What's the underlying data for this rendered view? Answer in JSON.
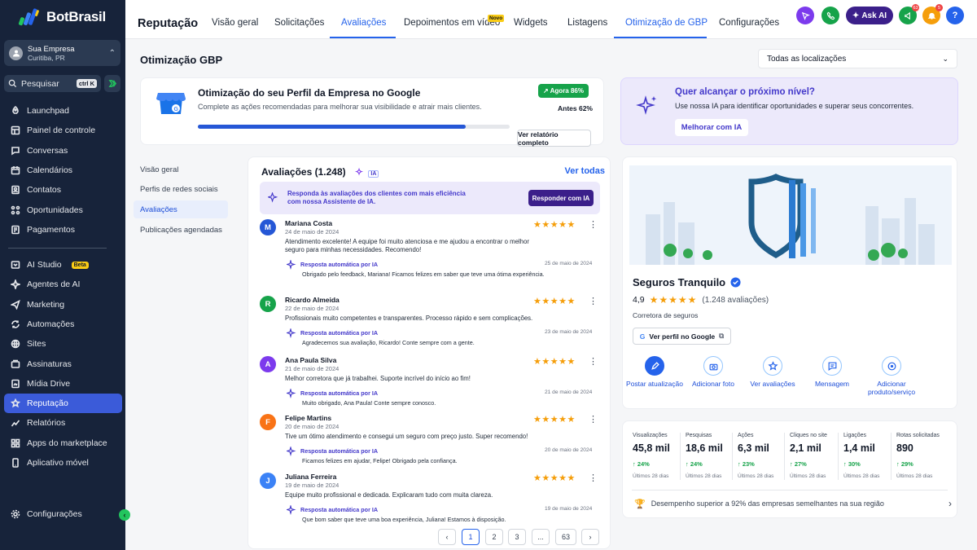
{
  "brand": {
    "name": "BotBrasil"
  },
  "company": {
    "name": "Sua Empresa",
    "city": "Curitiba, PR"
  },
  "search": {
    "label": "Pesquisar",
    "shortcut": "ctrl K"
  },
  "sidebar": {
    "items": [
      {
        "label": "Launchpad",
        "icon": "rocket-icon"
      },
      {
        "label": "Painel de controle",
        "icon": "dashboard-icon"
      },
      {
        "label": "Conversas",
        "icon": "chat-icon"
      },
      {
        "label": "Calendários",
        "icon": "calendar-icon"
      },
      {
        "label": "Contatos",
        "icon": "contacts-icon"
      },
      {
        "label": "Oportunidades",
        "icon": "opportunities-icon"
      },
      {
        "label": "Pagamentos",
        "icon": "payments-icon"
      }
    ],
    "items2": [
      {
        "label": "AI Studio",
        "icon": "ai-studio-icon",
        "badge": "Beta"
      },
      {
        "label": "Agentes de AI",
        "icon": "sparkle-icon"
      },
      {
        "label": "Marketing",
        "icon": "send-icon"
      },
      {
        "label": "Automações",
        "icon": "automation-icon"
      },
      {
        "label": "Sites",
        "icon": "globe-icon"
      },
      {
        "label": "Assinaturas",
        "icon": "subscriptions-icon"
      },
      {
        "label": "Mídia Drive",
        "icon": "media-icon"
      },
      {
        "label": "Reputação",
        "icon": "star-icon"
      },
      {
        "label": "Relatórios",
        "icon": "chart-icon"
      },
      {
        "label": "Apps do marketplace",
        "icon": "apps-icon"
      },
      {
        "label": "Aplicativo móvel",
        "icon": "mobile-icon"
      }
    ],
    "settings": "Configurações"
  },
  "header": {
    "title": "Reputação",
    "tabs": [
      "Visão geral",
      "Solicitações",
      "Avaliações",
      "Depoimentos em vídeo",
      "Widgets",
      "Listagens",
      "Otimização de GBP",
      "Configurações"
    ],
    "new_badge": "Novo",
    "ask_ai": "Ask AI",
    "notif_count_1": "63",
    "notif_count_2": "5",
    "help": "?"
  },
  "main": {
    "title": "Otimização GBP",
    "location_select": "Todas as localizações",
    "progress": {
      "title": "Otimização do seu Perfil da Empresa no Google",
      "subtitle": "Complete as ações recomendadas para melhorar sua visibilidade e atrair mais clientes.",
      "now_label": "Agora 86%",
      "before_label": "Antes 62%",
      "value_pct": 86,
      "report_button": "Ver relatório completo"
    },
    "ia_banner": {
      "title": "Quer alcançar o próximo nível?",
      "subtitle": "Use nossa IA para identificar oportunidades e superar seus concorrentes.",
      "button": "Melhorar com IA"
    },
    "subnav": [
      "Visão geral",
      "Perfis de redes sociais",
      "Avaliações",
      "Publicações agendadas"
    ],
    "reviews": {
      "title": "Avaliações (1.248)",
      "ia_tag": "IA",
      "see_all": "Ver todas",
      "tip": "Responda às avaliações dos clientes com mais eficiência com nossa Assistente de IA.",
      "tip_button": "Responder com IA",
      "reply_label": "Resposta automática por IA",
      "stars": "★★★★★",
      "items": [
        {
          "initial": "M",
          "color": "#2557d6",
          "name": "Mariana Costa",
          "date": "24 de maio de 2024",
          "text": "Atendimento excelente! A equipe foi muito atenciosa e me ajudou a encontrar o melhor seguro para minhas necessidades. Recomendo!",
          "reply_date": "25 de maio de 2024",
          "reply": "Obrigado pelo feedback, Mariana! Ficamos felizes em saber que teve uma ótima experiência."
        },
        {
          "initial": "R",
          "color": "#16a34a",
          "name": "Ricardo Almeida",
          "date": "22 de maio de 2024",
          "text": "Profissionais muito competentes e transparentes. Processo rápido e sem complicações.",
          "reply_date": "23 de maio de 2024",
          "reply": "Agradecemos sua avaliação, Ricardo! Conte sempre com a gente."
        },
        {
          "initial": "A",
          "color": "#7c3aed",
          "name": "Ana Paula Silva",
          "date": "21 de maio de 2024",
          "text": "Melhor corretora que já trabalhei. Suporte incrível do início ao fim!",
          "reply_date": "21 de maio de 2024",
          "reply": "Muito obrigado, Ana Paula! Conte sempre conosco."
        },
        {
          "initial": "F",
          "color": "#f97316",
          "name": "Felipe Martins",
          "date": "20 de maio de 2024",
          "text": "Tive um ótimo atendimento e consegui um seguro com preço justo. Super recomendo!",
          "reply_date": "20 de maio de 2024",
          "reply": "Ficamos felizes em ajudar, Felipe! Obrigado pela confiança."
        },
        {
          "initial": "J",
          "color": "#3b82f6",
          "name": "Juliana Ferreira",
          "date": "19 de maio de 2024",
          "text": "Equipe muito profissional e dedicada. Explicaram tudo com muita clareza.",
          "reply_date": "19 de maio de 2024",
          "reply": "Que bom saber que teve uma boa experiência, Juliana! Estamos à disposição."
        }
      ],
      "pages": [
        "1",
        "2",
        "3",
        "...",
        "63"
      ]
    },
    "profile": {
      "name": "Seguros Tranquilo",
      "rating": "4,9",
      "rating_stars": "★★★★★",
      "rating_count": "(1.248 avaliações)",
      "category": "Corretora de seguros",
      "google_button": "Ver perfil no Google",
      "actions": [
        {
          "label": "Postar atualização",
          "icon": "post-icon"
        },
        {
          "label": "Adicionar foto",
          "icon": "camera-icon"
        },
        {
          "label": "Ver avaliações",
          "icon": "star-outline-icon"
        },
        {
          "label": "Mensagem",
          "icon": "message-icon"
        },
        {
          "label": "Adicionar produto/serviço",
          "icon": "product-icon"
        }
      ]
    },
    "stats": [
      {
        "label": "Visualizações",
        "value": "45,8 mil",
        "pct": "24%",
        "period": "Últimos 28 dias"
      },
      {
        "label": "Pesquisas",
        "value": "18,6 mil",
        "pct": "24%",
        "period": "Últimos 28 dias"
      },
      {
        "label": "Ações",
        "value": "6,3 mil",
        "pct": "23%",
        "period": "Últimos 28 dias"
      },
      {
        "label": "Cliques no site",
        "value": "2,1 mil",
        "pct": "27%",
        "period": "Últimos 28 dias"
      },
      {
        "label": "Ligações",
        "value": "1,4 mil",
        "pct": "30%",
        "period": "Últimos 28 dias"
      },
      {
        "label": "Rotas solicitadas",
        "value": "890",
        "pct": "29%",
        "period": "Últimos 28 dias"
      }
    ],
    "performance": "Desempenho superior a 92% das empresas semelhantes na sua região"
  }
}
